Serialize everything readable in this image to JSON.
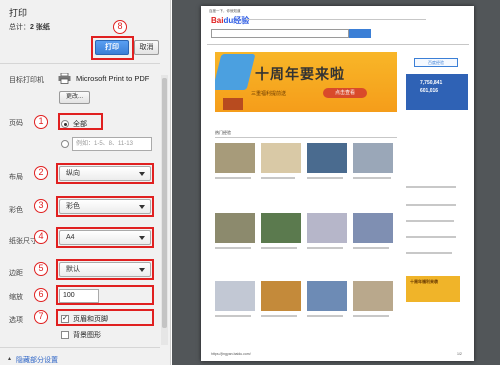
{
  "dialog": {
    "title": "打印",
    "total_label": "总计：",
    "total_value": "2 张纸",
    "print_button": "打印",
    "cancel_button": "取消"
  },
  "settings": {
    "destination": {
      "label": "目标打印机",
      "printer_name": "Microsoft Print to PDF",
      "change_button": "更改..."
    },
    "pages": {
      "label": "页码",
      "option_all": "全部",
      "option_custom_placeholder": "例如：1-5、8、11-13",
      "selected": "全部"
    },
    "layout": {
      "label": "布局",
      "value": "纵向"
    },
    "color": {
      "label": "彩色",
      "value": "彩色"
    },
    "paper_size": {
      "label": "纸张尺寸",
      "value": "A4"
    },
    "margins": {
      "label": "边距",
      "value": "默认"
    },
    "scale": {
      "label": "缩放",
      "value": "100"
    },
    "options": {
      "label": "选项",
      "headers_footers": {
        "label": "页眉和页脚",
        "checked": true
      },
      "background_graphics": {
        "label": "背景图形",
        "checked": false
      }
    },
    "hide_details_link": "隐藏部分设置"
  },
  "annotations": [
    "1",
    "2",
    "3",
    "4",
    "5",
    "6",
    "7",
    "8"
  ],
  "preview": {
    "header_left": "百度一下，你就知道",
    "banner_big_text": "十周年要来啦",
    "banner_small_text": "三重福利提前送",
    "banner_button": "点击查看",
    "login_button": "百度经验",
    "stats_line1": "7,750,841",
    "stats_line2": "601,016",
    "section_title": "热门经验",
    "url_footer": "https://jingyan.baidu.com/",
    "page_number": "1/2",
    "side_ad_text": "十周年福利来袭"
  },
  "watermark": {
    "text": "Baidu经验",
    "sub": "jingyan.baidu.com"
  },
  "colors": {
    "annotation_red": "#e02020",
    "primary_button": "#3b7fd6",
    "panel_bg": "#f1f1f1",
    "preview_bg": "#525659",
    "banner_orange": "#f8b628"
  }
}
